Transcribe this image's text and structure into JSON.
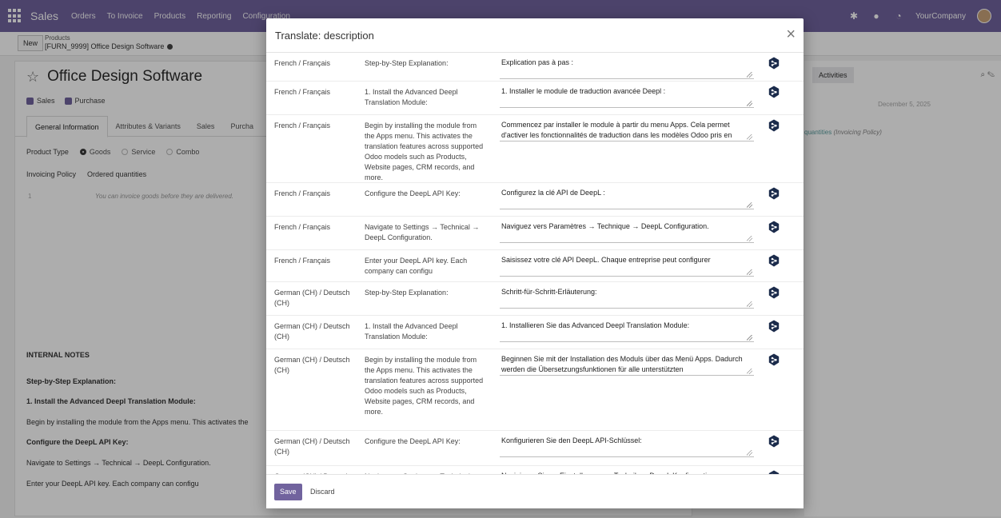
{
  "navbar": {
    "brand": "Sales",
    "menu": [
      "Orders",
      "To Invoice",
      "Products",
      "Reporting",
      "Configuration"
    ],
    "company": "YourCompany"
  },
  "control": {
    "new_label": "New",
    "breadcrumb_parent": "Products",
    "breadcrumb_current": "[FURN_9999] Office Design Software"
  },
  "product": {
    "title": "Office Design Software",
    "checks": [
      "Sales",
      "Purchase"
    ],
    "tabs": [
      "General Information",
      "Attributes & Variants",
      "Sales",
      "Purcha"
    ],
    "product_type_label": "Product Type",
    "product_type_options": [
      "Goods",
      "Service",
      "Combo"
    ],
    "invoicing_policy_label": "Invoicing Policy",
    "invoicing_policy_value": "Ordered quantities",
    "hint_num": "1",
    "hint": "You can invoice goods before they are delivered.",
    "notes_label": "INTERNAL NOTES",
    "notes": [
      {
        "text": "Step-by-Step Explanation:",
        "bold": true
      },
      {
        "text": "1. Install the Advanced Deepl Translation Module:",
        "bold": true
      },
      {
        "text": "Begin by installing the module from the Apps menu. This activates the",
        "bold": false
      },
      {
        "text": "Configure the DeepL API Key:",
        "bold": true
      },
      {
        "text": "Navigate to Settings → Technical → DeepL Configuration.",
        "bold": false
      },
      {
        "text": "Enter your DeepL API key. Each company can configu",
        "bold": false
      }
    ]
  },
  "chatter": {
    "activities_label": "Activities",
    "date": "December 5, 2025",
    "msg_a": "quantities",
    "msg_b": "(Invoicing Policy)"
  },
  "modal": {
    "title": "Translate: description",
    "close_glyph": "×",
    "save_label": "Save",
    "discard_label": "Discard",
    "rows": [
      {
        "lang": "French / Français",
        "source": "Step-by-Step Explanation:",
        "target": "Explication pas à pas :"
      },
      {
        "lang": "French / Français",
        "source": "1. Install the Advanced Deepl Translation Module:",
        "target": "1. Installer le module de traduction avancée Deepl :"
      },
      {
        "lang": "French / Français",
        "source": "Begin by installing the module from the Apps menu. This activates the translation features across supported Odoo models such as Products, Website pages, CRM records, and more.",
        "target": "Commencez par installer le module à partir du menu Apps. Cela permet d'activer les fonctionnalités de traduction dans les modèles Odoo pris en"
      },
      {
        "lang": "French / Français",
        "source": "Configure the DeepL API Key:",
        "target": "Configurez la clé API de DeepL :"
      },
      {
        "lang": "French / Français",
        "source": "Navigate to Settings → Technical → DeepL Configuration.",
        "target": "Naviguez vers Paramètres → Technique → DeepL Configuration."
      },
      {
        "lang": "French / Français",
        "source": "Enter your DeepL API key. Each company can configu",
        "target": "Saisissez votre clé API DeepL. Chaque entreprise peut configurer"
      },
      {
        "lang": "German (CH) / Deutsch (CH)",
        "source": "Step-by-Step Explanation:",
        "target": "Schritt-für-Schritt-Erläuterung:"
      },
      {
        "lang": "German (CH) / Deutsch (CH)",
        "source": "1. Install the Advanced Deepl Translation Module:",
        "target": "1. Installieren Sie das Advanced Deepl Translation Module:"
      },
      {
        "lang": "German (CH) / Deutsch (CH)",
        "source": "Begin by installing the module from the Apps menu. This activates the translation features across supported Odoo models such as Products, Website pages, CRM records, and more.",
        "target": "Beginnen Sie mit der Installation des Moduls über das Menü Apps. Dadurch werden die Übersetzungsfunktionen für alle unterstützten"
      },
      {
        "lang": "German (CH) / Deutsch (CH)",
        "source": "Configure the DeepL API Key:",
        "target": "Konfigurieren Sie den DeepL API-Schlüssel:"
      },
      {
        "lang": "German (CH) / Deutsch (CH)",
        "source": "Navigate to Settings → Technical → DeepL Configuration.",
        "target": "Navigieren Sie zu Einstellungen → Technik → DeepL Konfiguration."
      }
    ]
  },
  "colors": {
    "brand": "#71639e",
    "deepl": "#1b2b4b"
  }
}
